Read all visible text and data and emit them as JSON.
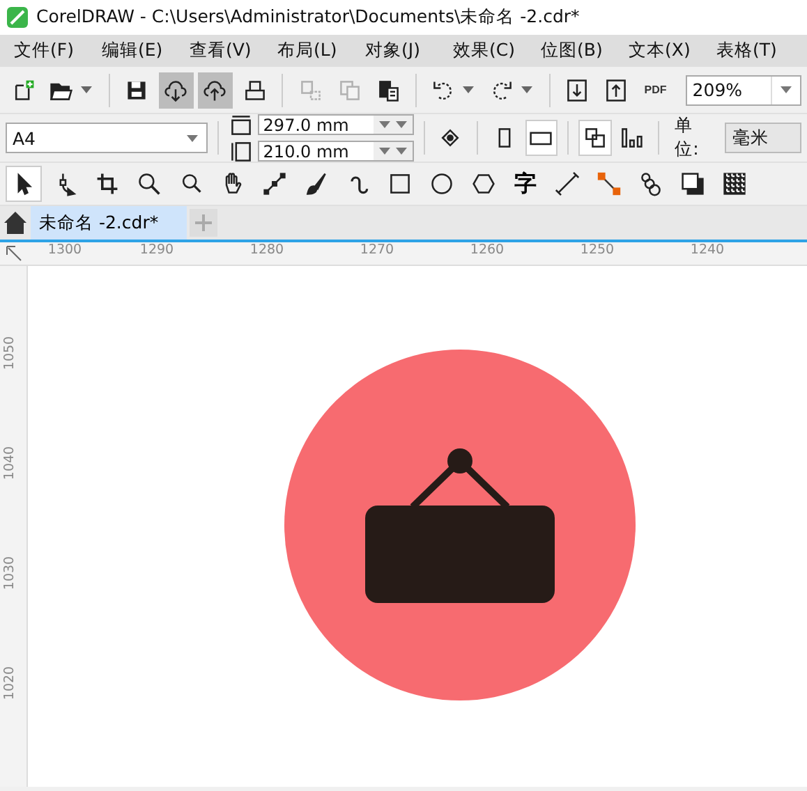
{
  "window": {
    "title": "CorelDRAW - C:\\Users\\Administrator\\Documents\\未命名 -2.cdr*"
  },
  "menu": [
    "文件(F)",
    "编辑(E)",
    "查看(V)",
    "布局(L)",
    "对象(J)",
    "效果(C)",
    "位图(B)",
    "文本(X)",
    "表格(T)"
  ],
  "toolbar": [
    {
      "kind": "new",
      "pressed": false,
      "disabled": false
    },
    {
      "kind": "open",
      "pressed": false,
      "disabled": false
    },
    {
      "kind": "sep"
    },
    {
      "kind": "save",
      "pressed": false,
      "disabled": false
    },
    {
      "kind": "download",
      "pressed": true,
      "disabled": false
    },
    {
      "kind": "upload",
      "pressed": true,
      "disabled": false
    },
    {
      "kind": "print",
      "pressed": false,
      "disabled": false
    },
    {
      "kind": "sep"
    },
    {
      "kind": "cut",
      "pressed": false,
      "disabled": true
    },
    {
      "kind": "copy",
      "pressed": false,
      "disabled": true
    },
    {
      "kind": "paste",
      "pressed": false,
      "disabled": false
    },
    {
      "kind": "sep"
    },
    {
      "kind": "undo",
      "pressed": false,
      "disabled": false
    },
    {
      "kind": "redo",
      "pressed": false,
      "disabled": false
    },
    {
      "kind": "sep"
    },
    {
      "kind": "import",
      "pressed": false,
      "disabled": false
    },
    {
      "kind": "export",
      "pressed": false,
      "disabled": false
    },
    {
      "kind": "pdf",
      "label": "PDF",
      "pressed": false,
      "disabled": false
    }
  ],
  "zoom": {
    "value": "209%"
  },
  "property_bar": {
    "page_size": "A4",
    "width": "297.0 mm",
    "height": "210.0 mm",
    "units_label": "单位:",
    "units": "毫米"
  },
  "toolbox": [
    {
      "kind": "pick",
      "selected": true
    },
    {
      "kind": "shape",
      "selected": false
    },
    {
      "kind": "crop",
      "selected": false
    },
    {
      "kind": "zoom",
      "selected": false
    },
    {
      "kind": "zoom2",
      "selected": false
    },
    {
      "kind": "hand",
      "selected": false
    },
    {
      "kind": "line",
      "selected": false
    },
    {
      "kind": "brush",
      "selected": false
    },
    {
      "kind": "curve",
      "selected": false
    },
    {
      "kind": "rect",
      "selected": false
    },
    {
      "kind": "ellipse",
      "selected": false
    },
    {
      "kind": "polygon",
      "selected": false
    },
    {
      "kind": "text",
      "label": "字",
      "selected": false
    },
    {
      "kind": "dimension",
      "selected": false
    },
    {
      "kind": "connector",
      "selected": false
    },
    {
      "kind": "blend",
      "selected": false
    },
    {
      "kind": "shadow",
      "selected": false
    },
    {
      "kind": "transparency",
      "selected": false
    }
  ],
  "tabs": [
    {
      "label": "未命名 -2.cdr*",
      "selected": true
    }
  ],
  "rulers": {
    "horizontal": [
      "1300",
      "1290",
      "1280",
      "1270",
      "1260",
      "1250",
      "1240"
    ],
    "vertical": [
      "1050",
      "1040",
      "1030",
      "1020"
    ]
  }
}
